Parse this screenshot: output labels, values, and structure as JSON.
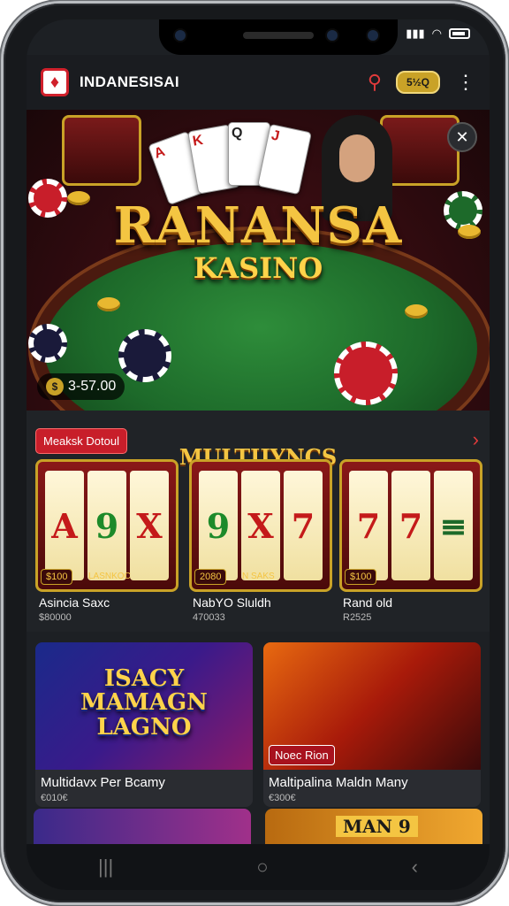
{
  "status": {
    "signal": "▮▮▮",
    "wifi": "◠"
  },
  "appbar": {
    "title": "INDANESISAI",
    "coins": "5½Q",
    "menu_icon": "⋮"
  },
  "hero": {
    "title": "RANANSA",
    "subtitle": "KASINO",
    "balance": "3-57.00",
    "close_icon": "✕"
  },
  "section": {
    "badge": "Meaksk Dotoul",
    "title": "MULTIJYNCS",
    "arrow": "›",
    "slots": [
      {
        "name": "Asincia Saxc",
        "amount": "$80000",
        "bet": "$100",
        "tag": "LASNKOC",
        "reels": [
          "A",
          "9",
          "X"
        ]
      },
      {
        "name": "NabYO Sluldh",
        "amount": "470033",
        "bet": "2080",
        "tag": "N SAKS",
        "reels": [
          "9",
          "X",
          "7"
        ]
      },
      {
        "name": "Rand old",
        "amount": "R2525",
        "bet": "$100",
        "tag": "",
        "reels": [
          "7",
          "7",
          "≡"
        ]
      }
    ]
  },
  "games": [
    {
      "name": "Multidavx Per Bcamy",
      "amount": "€010€",
      "title_lines": [
        "ISACY",
        "MAMAGN",
        "LAGNO"
      ],
      "tag": ""
    },
    {
      "name": "Maltipalina Maldn Many",
      "amount": "€300€",
      "title_lines": [],
      "tag": "Noec Rion"
    }
  ],
  "peek": {
    "right_label": "MAN 9"
  },
  "nav": {
    "back": "‹",
    "home": "○",
    "recents": "|||"
  }
}
